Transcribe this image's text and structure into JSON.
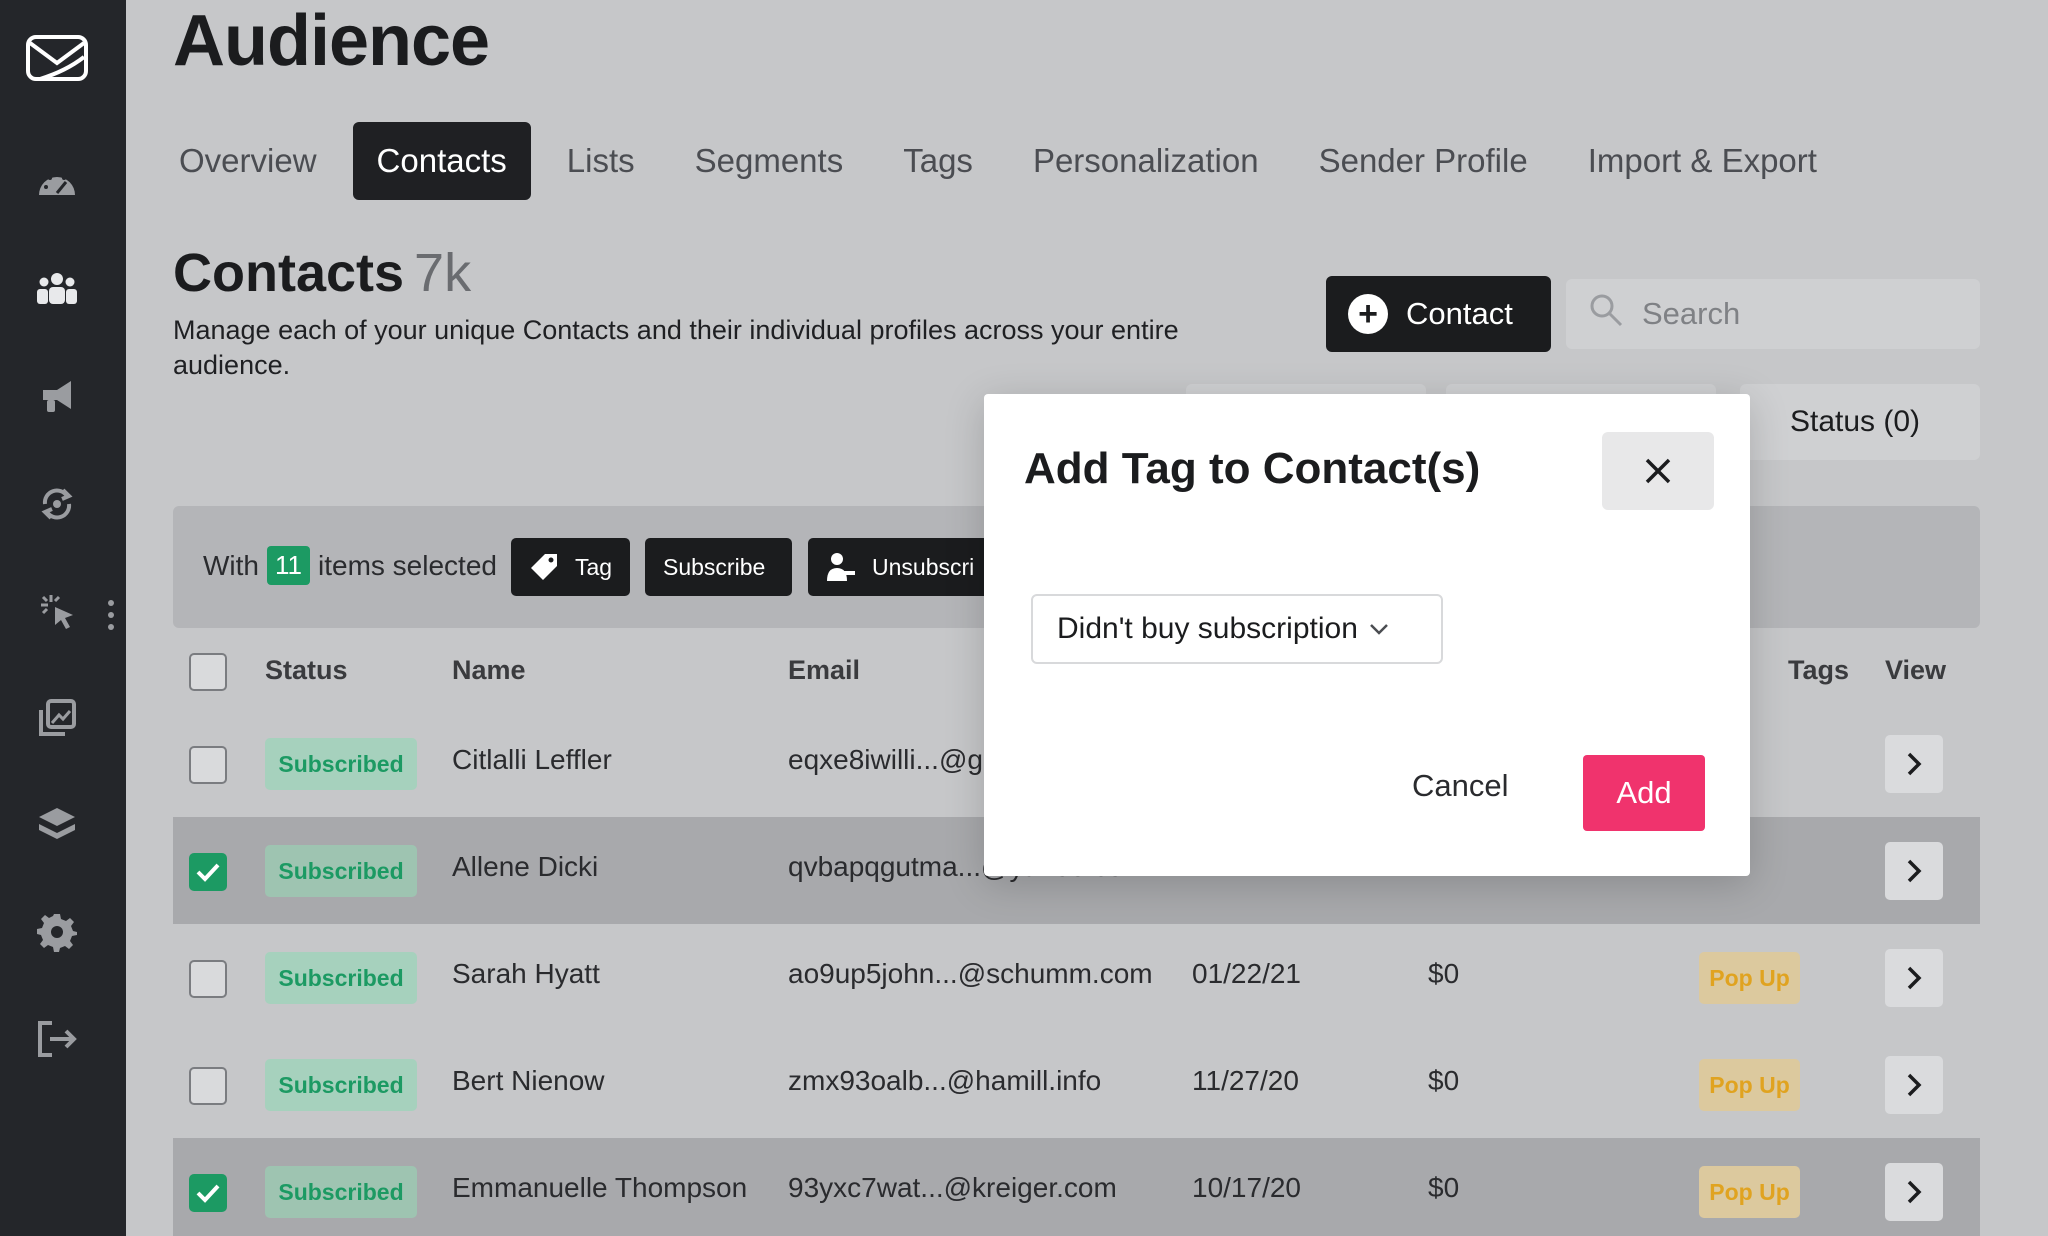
{
  "sidebar": {
    "icons": [
      "mail-logo-icon",
      "dashboard-gauge-icon",
      "audience-people-icon",
      "megaphone-icon",
      "automation-cycle-icon",
      "cursor-click-icon",
      "gallery-icon",
      "layers-icon",
      "settings-gear-icon",
      "logout-icon"
    ]
  },
  "page": {
    "title": "Audience"
  },
  "tabs": [
    {
      "label": "Overview",
      "active": false
    },
    {
      "label": "Contacts",
      "active": true
    },
    {
      "label": "Lists",
      "active": false
    },
    {
      "label": "Segments",
      "active": false
    },
    {
      "label": "Tags",
      "active": false
    },
    {
      "label": "Personalization",
      "active": false
    },
    {
      "label": "Sender Profile",
      "active": false
    },
    {
      "label": "Import & Export",
      "active": false
    }
  ],
  "section": {
    "title": "Contacts",
    "count": "7k",
    "description": "Manage each of your unique Contacts and their individual profiles across your entire audience."
  },
  "toolbar": {
    "contact_button": "Contact",
    "search_placeholder": "Search",
    "status_filter": "Status (0)"
  },
  "bulk": {
    "prefix": "With",
    "count": "11",
    "suffix": "items selected",
    "tag_label": "Tag",
    "subscribe_label": "Subscribe",
    "unsubscribe_label": "Unsubscri"
  },
  "table": {
    "headers": {
      "status": "Status",
      "name": "Name",
      "email": "Email",
      "tags": "Tags",
      "view": "View"
    },
    "rows": [
      {
        "checked": false,
        "status": "Subscribed",
        "name": "Citlalli Leffler",
        "email": "eqxe8iwilli...@gı",
        "date": "",
        "amount": "",
        "tag": ""
      },
      {
        "checked": true,
        "status": "Subscribed",
        "name": "Allene Dicki",
        "email": "qvbapqgutma...@yahoo.com",
        "date": "",
        "amount": "",
        "tag": ""
      },
      {
        "checked": false,
        "status": "Subscribed",
        "name": "Sarah Hyatt",
        "email": "ao9up5john...@schumm.com",
        "date": "01/22/21",
        "amount": "$0",
        "tag": "Pop Up"
      },
      {
        "checked": false,
        "status": "Subscribed",
        "name": "Bert Nienow",
        "email": "zmx93oalb...@hamill.info",
        "date": "11/27/20",
        "amount": "$0",
        "tag": "Pop Up"
      },
      {
        "checked": true,
        "status": "Subscribed",
        "name": "Emmanuelle Thompson",
        "email": "93yxc7wat...@kreiger.com",
        "date": "10/17/20",
        "amount": "$0",
        "tag": "Pop Up"
      }
    ]
  },
  "modal": {
    "title": "Add Tag to Contact(s)",
    "selected_tag": "Didn't buy subscription",
    "cancel_label": "Cancel",
    "add_label": "Add"
  },
  "colors": {
    "accent_pink": "#f0336d",
    "success_green": "#1c9a63",
    "popup_orange": "#e0a320",
    "sidebar_bg": "#24262a"
  }
}
